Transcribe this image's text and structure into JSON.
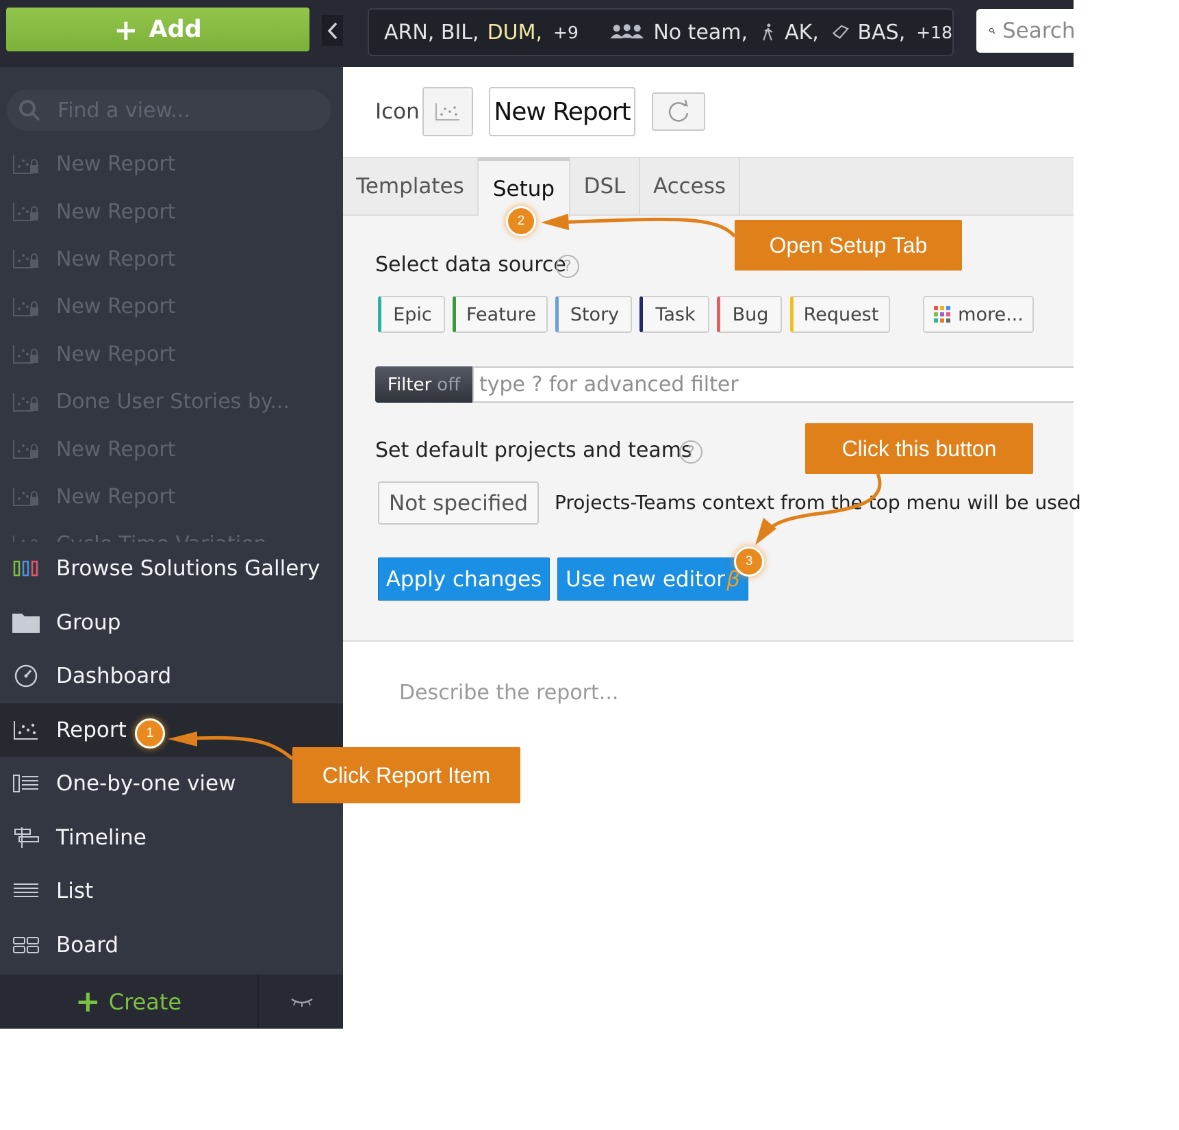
{
  "sidebar": {
    "add_label": "Add",
    "search_placeholder": "Find a view...",
    "views": [
      {
        "label": "New Report"
      },
      {
        "label": "New Report"
      },
      {
        "label": "New Report"
      },
      {
        "label": "New Report"
      },
      {
        "label": "New Report"
      },
      {
        "label": "Done User Stories by..."
      },
      {
        "label": "New Report"
      },
      {
        "label": "New Report"
      },
      {
        "label": "Cycle Time Variation"
      }
    ],
    "menu": [
      {
        "label": "Browse Solutions Gallery",
        "icon": "gallery-icon"
      },
      {
        "label": "Group",
        "icon": "folder-icon"
      },
      {
        "label": "Dashboard",
        "icon": "dashboard-icon"
      },
      {
        "label": "Report",
        "icon": "report-icon",
        "active": true
      },
      {
        "label": "One-by-one view",
        "icon": "one-by-one-icon"
      },
      {
        "label": "Timeline",
        "icon": "timeline-icon"
      },
      {
        "label": "List",
        "icon": "list-icon"
      },
      {
        "label": "Board",
        "icon": "board-icon"
      }
    ],
    "create_label": "Create"
  },
  "topbar": {
    "projects": "ARN,  BIL,",
    "projects_highlight": "DUM,",
    "projects_more": "+9",
    "teams": "No team,",
    "people": "AK,",
    "types": "BAS,",
    "types_more": "+18",
    "search_placeholder": "Search"
  },
  "header": {
    "icon_label": "Icon",
    "title": "New Report"
  },
  "tabs": [
    {
      "label": "Templates"
    },
    {
      "label": "Setup",
      "active": true
    },
    {
      "label": "DSL"
    },
    {
      "label": "Access"
    }
  ],
  "setup": {
    "data_source_label": "Select data source",
    "data_sources": [
      {
        "label": "Epic",
        "color": "#2bb39b"
      },
      {
        "label": "Feature",
        "color": "#3a9a3a"
      },
      {
        "label": "Story",
        "color": "#6aa0e0"
      },
      {
        "label": "Task",
        "color": "#1f2a6a"
      },
      {
        "label": "Bug",
        "color": "#e06060"
      },
      {
        "label": "Request",
        "color": "#f0c020"
      }
    ],
    "more_label": "more...",
    "filter_label": "Filter",
    "filter_state": "off",
    "filter_placeholder": "type ? for advanced filter",
    "projects_teams_label": "Set default projects and teams",
    "not_specified_label": "Not specified",
    "context_note": "Projects-Teams context from the top menu will be used",
    "apply_label": "Apply changes",
    "new_editor_label": "Use new editor",
    "beta_symbol": "β"
  },
  "description_placeholder": "Describe the report...",
  "annotations": {
    "callout_1": "Click Report Item",
    "callout_2": "Open Setup Tab",
    "callout_3": "Click this button",
    "step_1": "1",
    "step_2": "2",
    "step_3": "3",
    "accent_color": "#e0801b"
  }
}
